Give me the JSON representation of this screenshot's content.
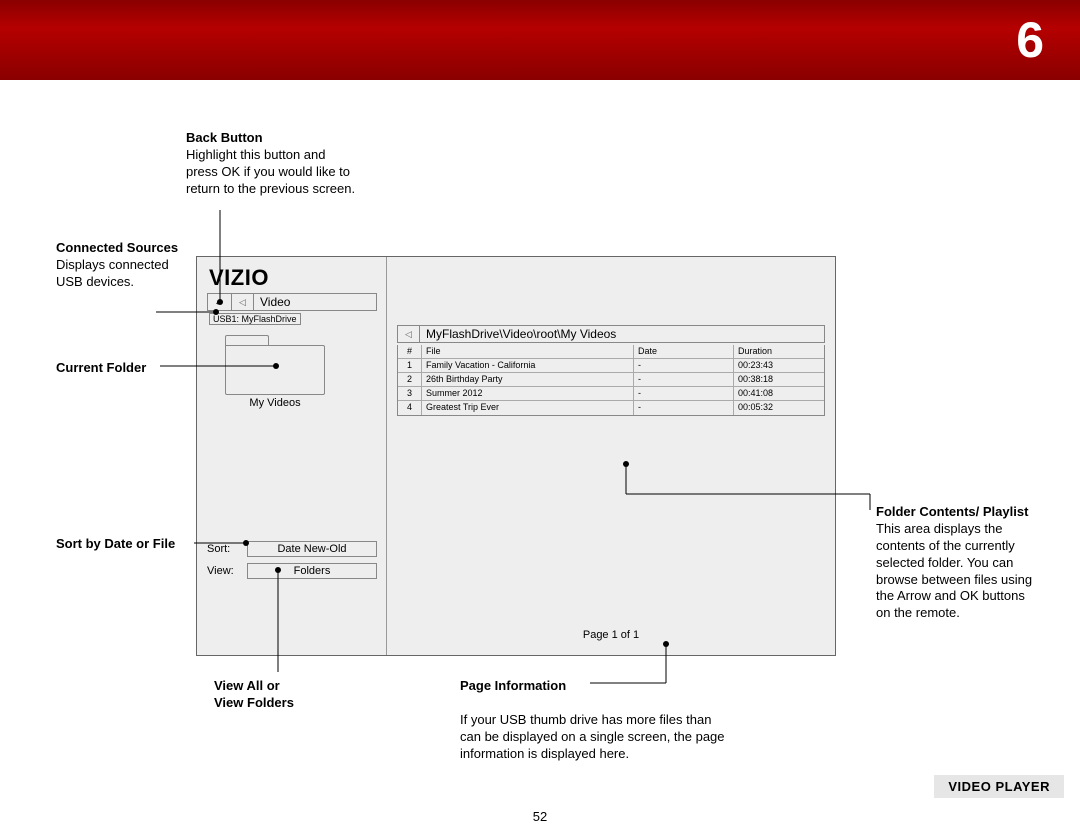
{
  "chapter_number": "6",
  "page_number": "52",
  "caption": "VIDEO PLAYER",
  "callouts": {
    "back_button": {
      "title": "Back Button",
      "body": "Highlight this button and press OK if you would like to return to the previous screen."
    },
    "connected_sources": {
      "title": "Connected Sources",
      "body": "Displays connected USB devices."
    },
    "current_folder": {
      "title": "Current Folder"
    },
    "sort_by": {
      "title": "Sort by Date or File"
    },
    "view_all": {
      "title_line1": "View All or",
      "title_line2": "View Folders"
    },
    "page_info": {
      "title": "Page Information",
      "body": "If your USB thumb drive has more files than can be displayed on a single screen, the page information is displayed here."
    },
    "folder_contents": {
      "title": "Folder Contents/ Playlist",
      "body": "This area displays the contents of the currently selected folder. You can browse between files using the Arrow and OK buttons on the remote."
    }
  },
  "screen": {
    "logo": "VIZIO",
    "back_arrow": "←",
    "tri_left": "◁",
    "nav_category": "Video",
    "usb_device": "USB1: MyFlashDrive",
    "current_folder": "My Videos",
    "sort_label": "Sort:",
    "sort_value": "Date New-Old",
    "view_label": "View:",
    "view_value": "Folders",
    "path": "MyFlashDrive\\Video\\root\\My Videos",
    "headers": {
      "num": "#",
      "file": "File",
      "date": "Date",
      "duration": "Duration"
    },
    "rows": [
      {
        "num": "1",
        "file": "Family Vacation - California",
        "date": "-",
        "duration": "00:23:43"
      },
      {
        "num": "2",
        "file": "26th Birthday Party",
        "date": "-",
        "duration": "00:38:18"
      },
      {
        "num": "3",
        "file": "Summer 2012",
        "date": "-",
        "duration": "00:41:08"
      },
      {
        "num": "4",
        "file": "Greatest Trip Ever",
        "date": "-",
        "duration": "00:05:32"
      }
    ],
    "page_info": "Page 1 of 1"
  }
}
